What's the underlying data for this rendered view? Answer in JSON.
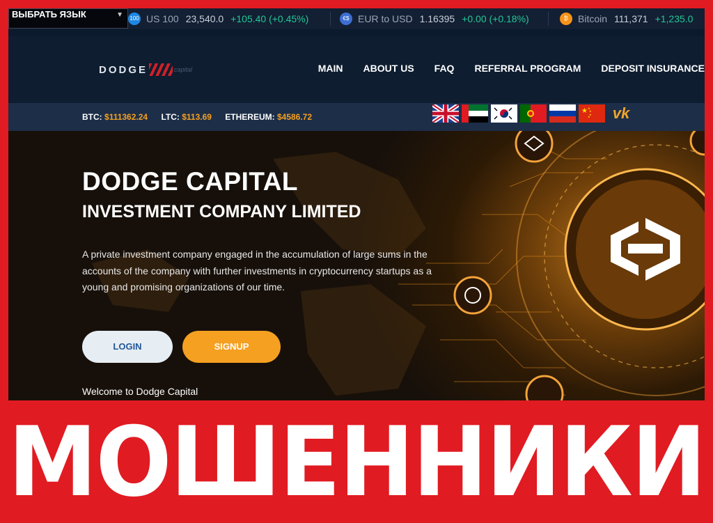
{
  "language_selector": {
    "label": "ВЫБРАТЬ ЯЗЫК",
    "icon": "chevron-down-icon"
  },
  "ticker": [
    {
      "icon_text": "100",
      "icon_color": "#1e88e5",
      "name": "US 100",
      "price": "23,540.0",
      "change": "+105.40 (+0.45%)"
    },
    {
      "icon_text": "€$",
      "icon_color": "#3c6fd0",
      "name": "EUR to USD",
      "price": "1.16395",
      "change": "+0.00 (+0.18%)"
    },
    {
      "icon_text": "₿",
      "icon_color": "#f7931a",
      "name": "Bitcoin",
      "price": "111,371",
      "change": "+1,235.0"
    }
  ],
  "logo": {
    "text": "DODGE",
    "sub": "capital"
  },
  "nav": [
    "MAIN",
    "ABOUT US",
    "FAQ",
    "REFERRAL PROGRAM",
    "DEPOSIT INSURANCE"
  ],
  "prices": [
    {
      "label": "BTC:",
      "value": "$111362.24"
    },
    {
      "label": "LTC:",
      "value": "$113.69"
    },
    {
      "label": "ETHEREUM:",
      "value": "$4586.72"
    }
  ],
  "flags": [
    "uk-flag",
    "uae-flag",
    "korea-flag",
    "portugal-flag",
    "russia-flag",
    "china-flag"
  ],
  "social": {
    "vk": "vk"
  },
  "hero": {
    "title": "DODGE CAPITAL",
    "subtitle": "INVESTMENT COMPANY LIMITED",
    "description": "A private investment company engaged in the accumulation of large sums in the accounts of the company with further investments in cryptocurrency startups as a young and promising organizations of our time.",
    "login": "LOGIN",
    "signup": "SIGNUP",
    "welcome": "Welcome to Dodge Capital"
  },
  "banner": "МОШЕННИКИ",
  "colors": {
    "accent": "#f5a021",
    "banner_red": "#e11b22",
    "positive": "#20c997"
  }
}
